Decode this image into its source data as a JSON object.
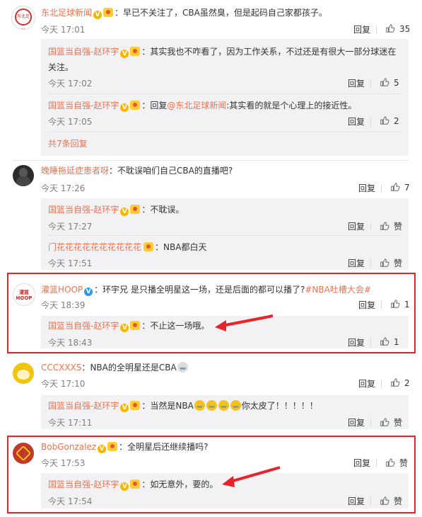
{
  "labels": {
    "reply": "回复",
    "like_empty": "赞"
  },
  "comments": [
    {
      "name": "东北足球新闻",
      "text": "早已不关注了，CBA虽然臭，但是起码自己家都孩子。",
      "time": "今天 17:01",
      "likes": "35",
      "replies": [
        {
          "name": "国篮当自强-赵环宇",
          "text": "其实我也不咋看了，因为工作关系，不过还是有很大一部分球迷在",
          "text2": "关注。",
          "time": "今天 17:02",
          "likes": "5"
        },
        {
          "name": "国篮当自强-赵环宇",
          "reply_prefix": "回复",
          "mention": "@东北足球新闻",
          "text": ":其实看的就是个心理上的接近性。",
          "time": "今天 17:05",
          "likes": "2"
        }
      ],
      "more": "共7条回复"
    },
    {
      "name": "晚睡拖延症患者呀",
      "text": "不耽误咱们自己CBA的直播吧?",
      "time": "今天 17:26",
      "likes": "7",
      "replies": [
        {
          "name": "国篮当自强-赵环宇",
          "text": "不耽误。",
          "time": "今天 17:27",
          "likes": ""
        },
        {
          "name": "门花花花花花花花花花花",
          "text": "NBA都白天",
          "time": "今天 17:51",
          "likes": ""
        }
      ]
    },
    {
      "name": "灌篮HOOP",
      "text": "环宇兄 是只播全明星这一场，还是后面的都可以播了?",
      "tag": "#NBA吐槽大会#",
      "time": "今天 18:39",
      "likes": "1",
      "replies": [
        {
          "name": "国篮当自强-赵环宇",
          "text": "不止这一场哦。",
          "time": "今天 18:43",
          "likes": "1"
        }
      ]
    },
    {
      "name": "CCCXXXS",
      "text": "NBA的全明星还是CBA",
      "time": "今天 17:10",
      "likes": "2",
      "replies": [
        {
          "name": "国篮当自强-赵环宇",
          "text_before": "当然是NBA",
          "text_after": "你太皮了！！！！！",
          "time": "今天 17:11",
          "likes": ""
        }
      ]
    },
    {
      "name": "BobGonzalez",
      "text": "全明星后还继续播吗?",
      "time": "今天 17:53",
      "likes": "",
      "replies": [
        {
          "name": "国篮当自强-赵环宇",
          "text": "如无意外，要的。",
          "time": "今天 17:54",
          "likes": ""
        }
      ]
    }
  ],
  "avatars": {
    "c0": "东北足球",
    "c2": "灌篮 HOOP"
  },
  "colors": {
    "accent": "#eb7350",
    "highlight_box": "#e8232b",
    "sub_bg": "#f2f2f5"
  }
}
